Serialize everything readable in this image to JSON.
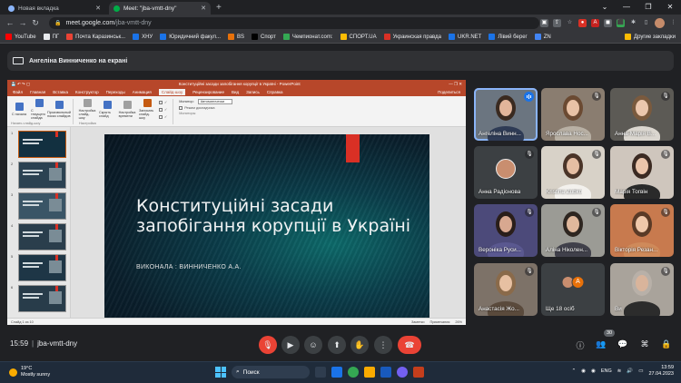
{
  "browser": {
    "tabs": [
      {
        "title": "Новая вкладка",
        "active": false,
        "favicon_color": "#8ab4f8"
      },
      {
        "title": "Meet: \"jba-vmtt-dny\"",
        "active": true,
        "favicon_color": "#00ac47"
      }
    ],
    "url_host": "meet.google.com",
    "url_path": "/jba-vmtt-dny",
    "bookmarks": [
      {
        "label": "YouTube",
        "color": "#ff0000"
      },
      {
        "label": "ПГ",
        "color": "#e8eaed"
      },
      {
        "label": "Почта Каразинськ...",
        "color": "#ea4335"
      },
      {
        "label": "ХНУ",
        "color": "#1a73e8"
      },
      {
        "label": "Юридичний факул...",
        "color": "#1a73e8"
      },
      {
        "label": "BS",
        "color": "#e8710a"
      },
      {
        "label": "Спорт",
        "color": "#000000"
      },
      {
        "label": "Чемпионат.com:",
        "color": "#34a853"
      },
      {
        "label": "СПОРТ.UA",
        "color": "#fbbc04"
      },
      {
        "label": "Украинская правда",
        "color": "#d93025"
      },
      {
        "label": "UKR.NET",
        "color": "#1a73e8"
      },
      {
        "label": "Лівий берег",
        "color": "#1a73e8"
      },
      {
        "label": "ZN",
        "color": "#4285f4"
      }
    ],
    "other_bookmarks": "Другие закладки"
  },
  "meet": {
    "presenting_text": "Ангеліна Винниченко на екрані",
    "time": "15:59",
    "meeting_code": "jba-vmtt-dny",
    "people_count": "30",
    "participants": [
      {
        "name": "Ангеліна Винн...",
        "speaking": true
      },
      {
        "name": "Ярослава Нос..."
      },
      {
        "name": "Анна-Марія В..."
      },
      {
        "name": "Анна Радіонова"
      },
      {
        "name": "Kristina Zubko"
      },
      {
        "name": "Марія Тогвін"
      },
      {
        "name": "Вероніка Руси..."
      },
      {
        "name": "Аліна Ніколен..."
      },
      {
        "name": "Вікторія Резан..."
      },
      {
        "name": "Анастасія Жо..."
      },
      {
        "name": "Ще 18 осіб",
        "letter": "А"
      },
      {
        "name": "Ви"
      }
    ]
  },
  "powerpoint": {
    "title": "Конституційні засади запобігання корупції в Україні - PowerPoint",
    "menu": [
      "Файл",
      "Главная",
      "Вставка",
      "Конструктор",
      "Переходы",
      "Анимация",
      "Слайд-шоу",
      "Рецензирование",
      "Вид",
      "Запись",
      "Справка"
    ],
    "active_menu": "Слайд-шоу",
    "share_label": "Поделиться",
    "ribbon": {
      "start_beginning": "С начала",
      "from_current": "С текущего слайда",
      "custom_show": "Произвольный показ слайдов",
      "setup": "Настройка слайд-шоу",
      "hide_slide": "Скрыть слайд",
      "rehearse": "Настройка времени",
      "record": "Записать слайд-шоу",
      "monitor": "Монитор:",
      "monitor_value": "Автоматически",
      "presenter_view": "Режим докладчика",
      "group1": "Начать слайд-шоу",
      "group2": "Настройка",
      "group3": "Мониторы"
    },
    "slide_title": "Конституційні засади запобігання корупції в Україні",
    "slide_subtitle": "ВИКОНАЛА : ВИННИЧЕНКО А.А.",
    "status_left": "Слайд 1 из 10",
    "status_notes": "Заметки",
    "status_comments": "Примечания",
    "zoom": "26%"
  },
  "taskbar": {
    "temp": "19°C",
    "weather": "Mostly sunny",
    "search": "Поиск",
    "lang": "ENG",
    "time": "13:59",
    "date": "27.04.2023"
  }
}
